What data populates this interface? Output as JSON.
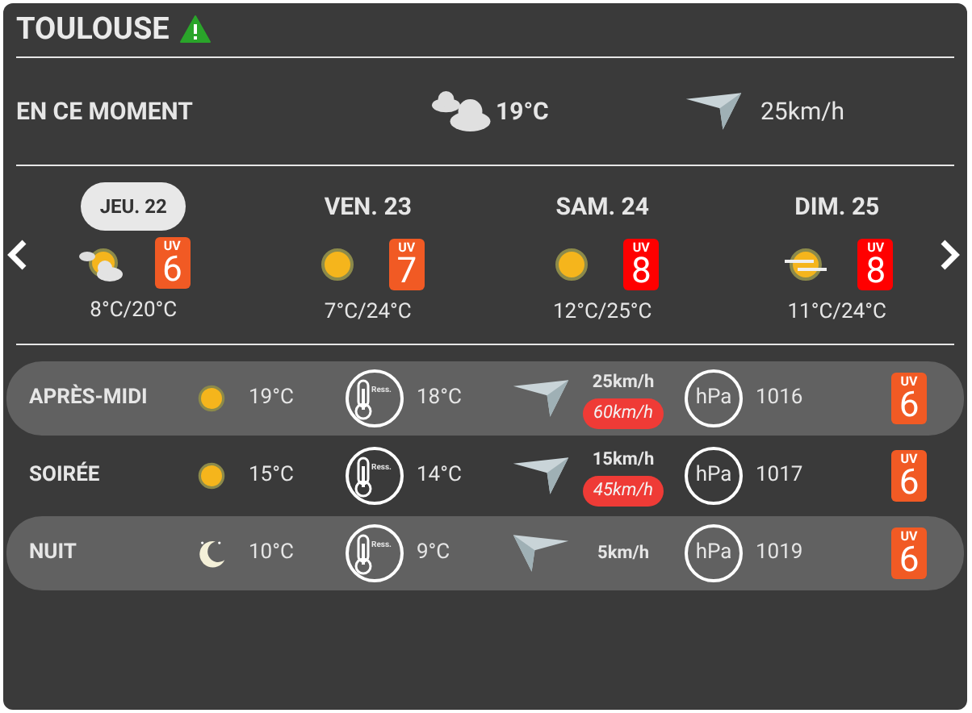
{
  "title": "TOULOUSE",
  "current": {
    "label": "EN CE MOMENT",
    "weather": {
      "kind": "cloudy"
    },
    "temperature": "19°C",
    "wind_arrow": {
      "kind": "right"
    },
    "wind": "25km/h"
  },
  "days": [
    {
      "label": "JEU. 22",
      "selected": true,
      "weather": {
        "kind": "partly_cloudy"
      },
      "uv_label": "UV",
      "uv": "6",
      "color": "#f15a24",
      "temps": "8°C/20°C"
    },
    {
      "label": "VEN. 23",
      "selected": false,
      "weather": {
        "kind": "sunny"
      },
      "uv_label": "UV",
      "uv": "7",
      "color": "#f15a24",
      "temps": "7°C/24°C"
    },
    {
      "label": "SAM. 24",
      "selected": false,
      "weather": {
        "kind": "sunny"
      },
      "uv_label": "UV",
      "uv": "8",
      "color": "#ff0000",
      "temps": "12°C/25°C"
    },
    {
      "label": "DIM. 25",
      "selected": false,
      "weather": {
        "kind": "hazy"
      },
      "uv_label": "UV",
      "uv": "8",
      "color": "#ff0000",
      "temps": "11°C/24°C"
    }
  ],
  "periods": [
    {
      "label": "APRÈS-MIDI",
      "weather": {
        "kind": "sunny"
      },
      "temperature": "19°C",
      "feels_icon_label": "Ress.",
      "feels": "18°C",
      "wind_arrow": {
        "kind": "right"
      },
      "wind": "25km/h",
      "gust": "60km/h",
      "pressure_unit": "hPa",
      "pressure": "1016",
      "uv_label": "UV",
      "uv": "6"
    },
    {
      "label": "SOIRÉE",
      "weather": {
        "kind": "sunny"
      },
      "temperature": "15°C",
      "feels_icon_label": "Ress.",
      "feels": "14°C",
      "wind_arrow": {
        "kind": "right"
      },
      "wind": "15km/h",
      "gust": "45km/h",
      "pressure_unit": "hPa",
      "pressure": "1017",
      "uv_label": "UV",
      "uv": "6"
    },
    {
      "label": "NUIT",
      "weather": {
        "kind": "clear_night"
      },
      "temperature": "10°C",
      "feels_icon_label": "Ress.",
      "feels": "9°C",
      "wind_arrow": {
        "kind": "left"
      },
      "wind": "5km/h",
      "pressure_unit": "hPa",
      "pressure": "1019",
      "uv_label": "UV",
      "uv": "6"
    }
  ]
}
